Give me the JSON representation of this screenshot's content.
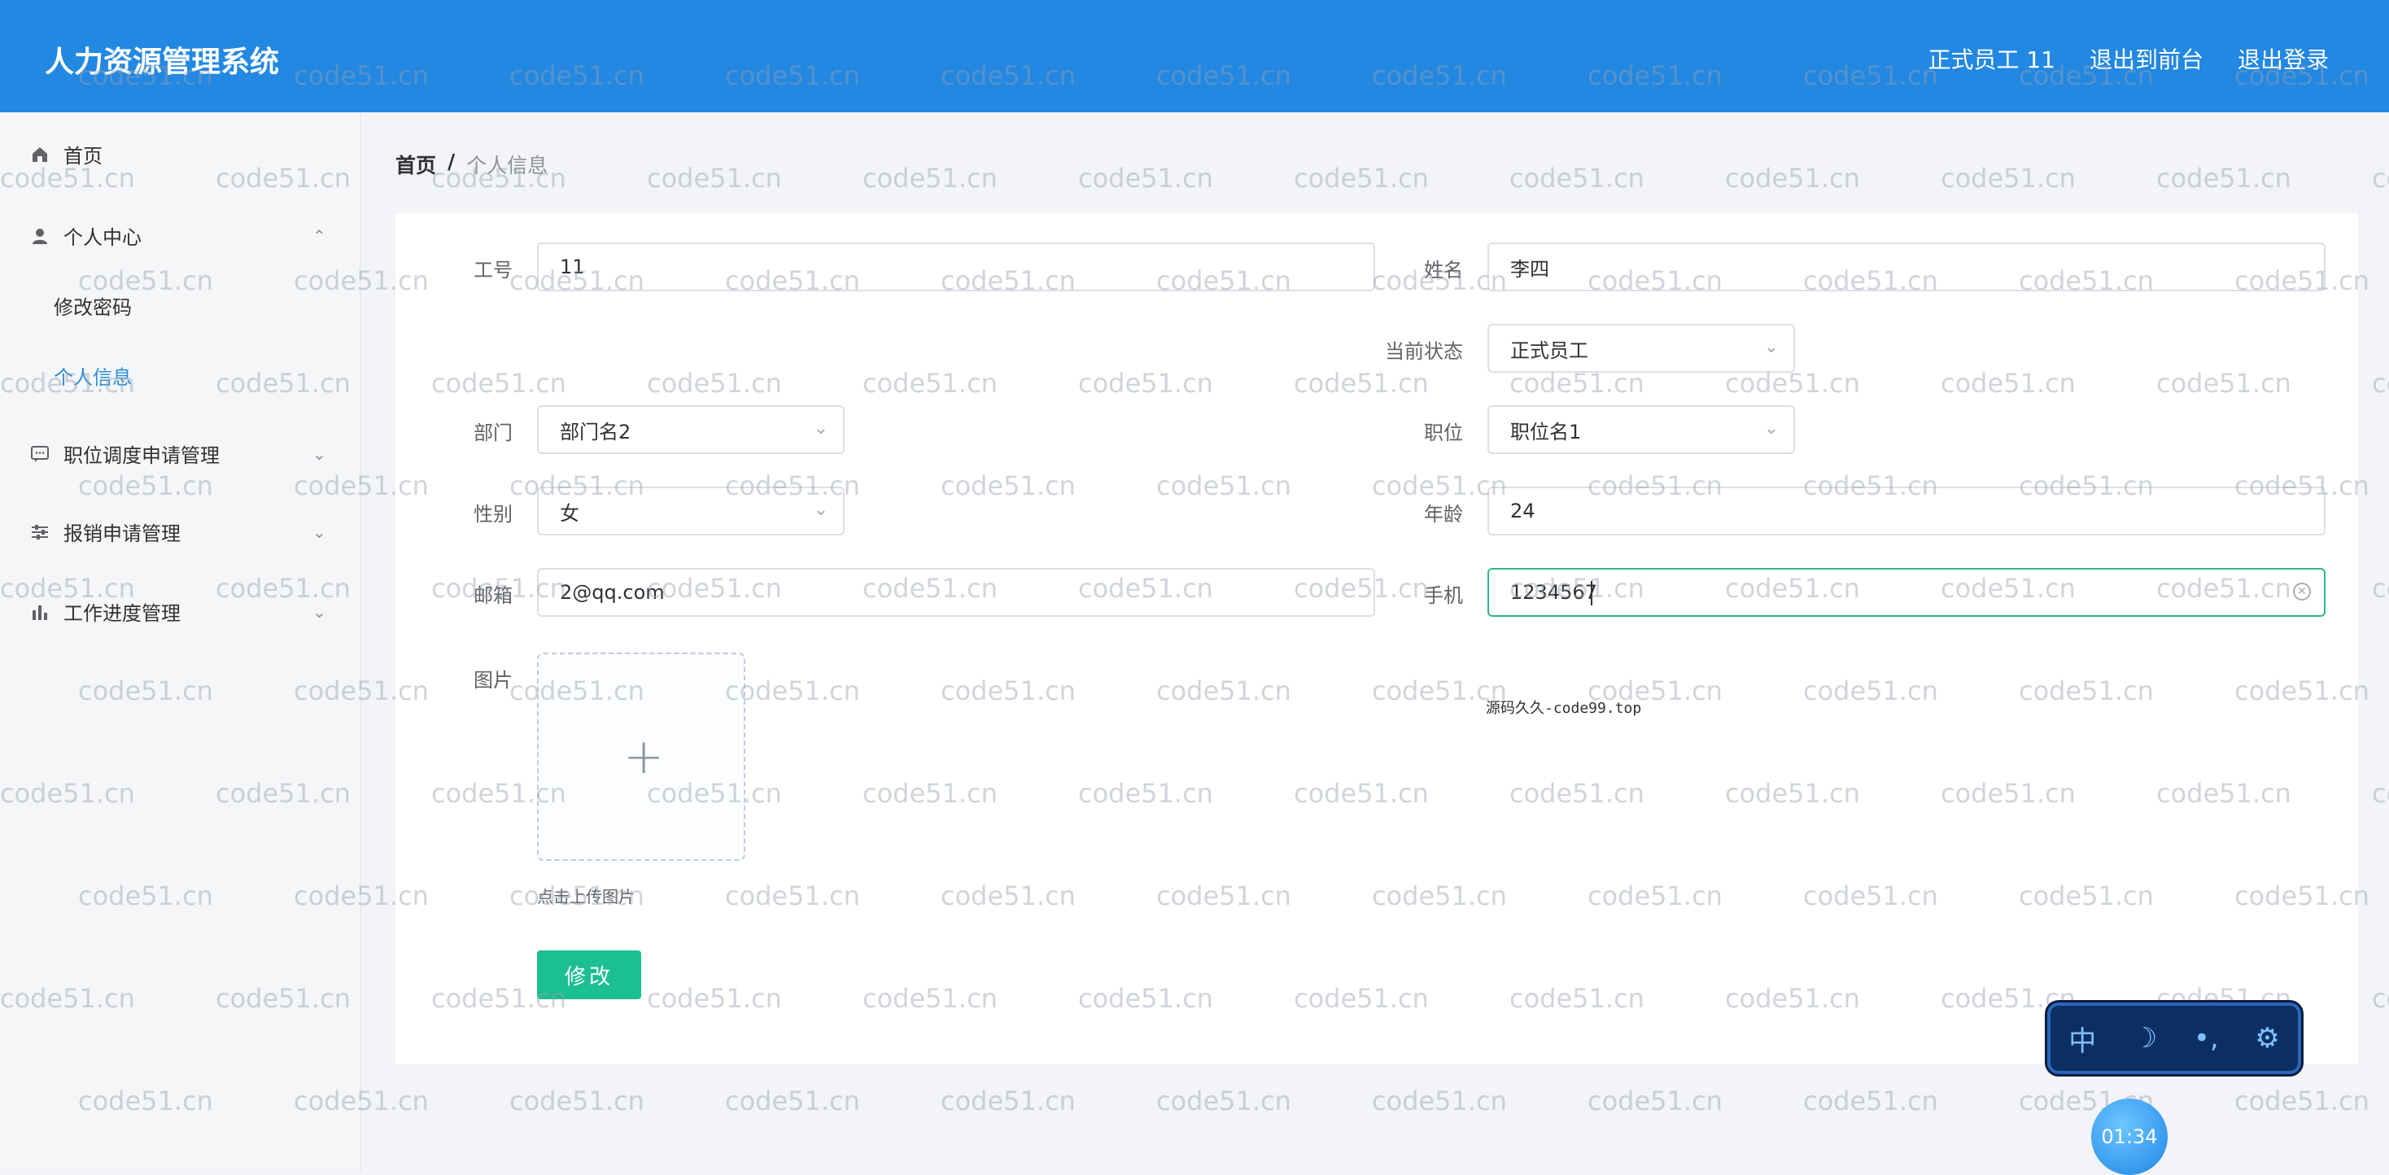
{
  "header": {
    "app_title": "人力资源管理系统",
    "user_label": "正式员工 11",
    "back_to_front": "退出到前台",
    "logout": "退出登录"
  },
  "sidebar": {
    "items": [
      {
        "label": "首页",
        "icon": "home-icon"
      },
      {
        "label": "个人中心",
        "icon": "user-icon"
      },
      {
        "label": "修改密码"
      },
      {
        "label": "个人信息"
      },
      {
        "label": "职位调度申请管理",
        "icon": "message-icon"
      },
      {
        "label": "报销申请管理",
        "icon": "sliders-icon"
      },
      {
        "label": "工作进度管理",
        "icon": "bar-chart-icon"
      }
    ]
  },
  "breadcrumb": {
    "home": "首页",
    "separator": "/",
    "current": "个人信息"
  },
  "form": {
    "job_no": {
      "label": "工号",
      "value": "11"
    },
    "name": {
      "label": "姓名",
      "value": "李四"
    },
    "status": {
      "label": "当前状态",
      "value": "正式员工"
    },
    "department": {
      "label": "部门",
      "value": "部门名2"
    },
    "position": {
      "label": "职位",
      "value": "职位名1"
    },
    "gender": {
      "label": "性别",
      "value": "女"
    },
    "age": {
      "label": "年龄",
      "value": "24"
    },
    "email": {
      "label": "邮箱",
      "value": "2@qq.com"
    },
    "phone": {
      "label": "手机",
      "value": "1234567"
    },
    "photo": {
      "label": "图片",
      "tip": "点击上传图片"
    },
    "submit_label": "修改"
  },
  "overlay_note": "源码久久-code99.top",
  "watermark_text": "code51.cn",
  "widget": {
    "buttons": [
      "中",
      "☽",
      "•,",
      "⚙"
    ],
    "timer": "01:34"
  },
  "colors": {
    "header_bg": "#2288e2",
    "active_menu": "#2b8fd8",
    "primary_button": "#1bbf93",
    "focus_border": "#2fb889"
  }
}
